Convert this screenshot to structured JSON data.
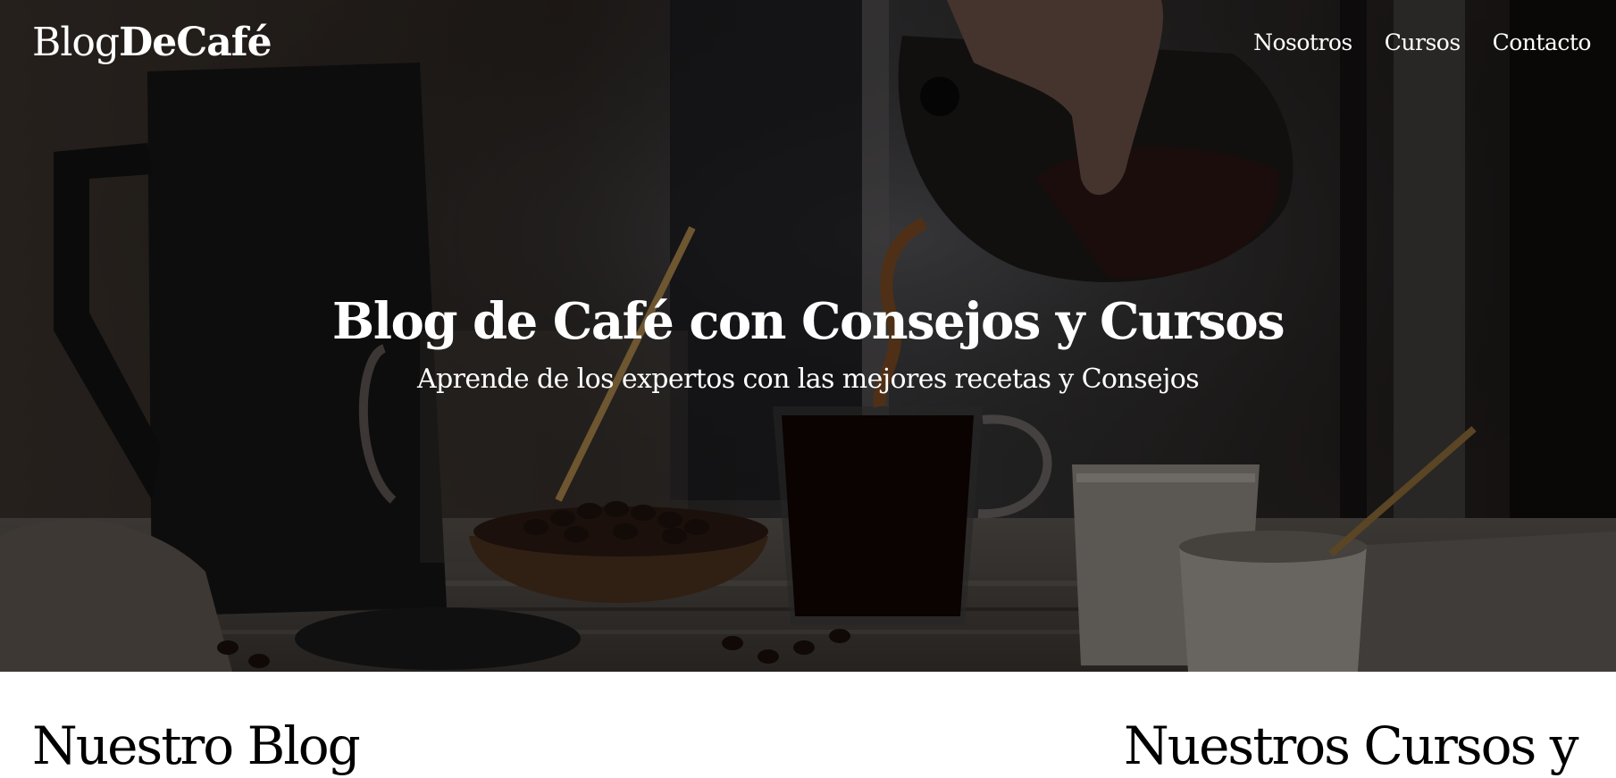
{
  "header": {
    "logo_light": "Blog",
    "logo_bold": "DeCafé",
    "nav": [
      {
        "label": "Nosotros"
      },
      {
        "label": "Cursos"
      },
      {
        "label": "Contacto"
      }
    ]
  },
  "hero": {
    "title": "Blog de Café con Consejos y Cursos",
    "subtitle": "Aprende de los expertos con las mejores recetas y Consejos"
  },
  "sections": {
    "blog_heading": "Nuestro Blog",
    "courses_heading": "Nuestros Cursos y"
  }
}
